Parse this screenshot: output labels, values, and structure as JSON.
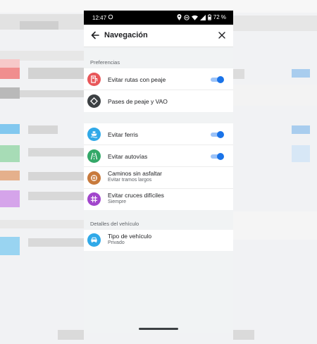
{
  "status_bar": {
    "time": "12:47",
    "battery": "72 %"
  },
  "app_bar": {
    "title": "Navegación"
  },
  "sections": {
    "preferences": "Preferencias",
    "vehicle": "Detalles del vehículo"
  },
  "rows": [
    {
      "label": "Evitar rutas con peaje",
      "sub": "",
      "icon": "toll-icon",
      "icon_color": "#e8575a",
      "toggle": true
    },
    {
      "label": "Pases de peaje y VAO",
      "sub": "",
      "icon": "diamond-icon",
      "icon_color": "#3c4043",
      "toggle": null
    },
    {
      "label": "Evitar ferris",
      "sub": "",
      "icon": "ferry-icon",
      "icon_color": "#30a9e8",
      "toggle": true
    },
    {
      "label": "Evitar autovías",
      "sub": "",
      "icon": "highway-icon",
      "icon_color": "#34a868",
      "toggle": true
    },
    {
      "label": "Caminos sin asfaltar",
      "sub": "Evitar tramos largos",
      "icon": "unpaved-road-icon",
      "icon_color": "#c87a3c",
      "toggle": null
    },
    {
      "label": "Evitar cruces difíciles",
      "sub": "Siempre",
      "icon": "intersection-icon",
      "icon_color": "#a146cc",
      "toggle": null
    },
    {
      "label": "Tipo de vehículo",
      "sub": "Privado",
      "icon": "car-icon",
      "icon_color": "#30a9e8",
      "toggle": null
    }
  ],
  "colors": {
    "accent": "#1a73e8",
    "accent_track": "#9cc3f8"
  }
}
